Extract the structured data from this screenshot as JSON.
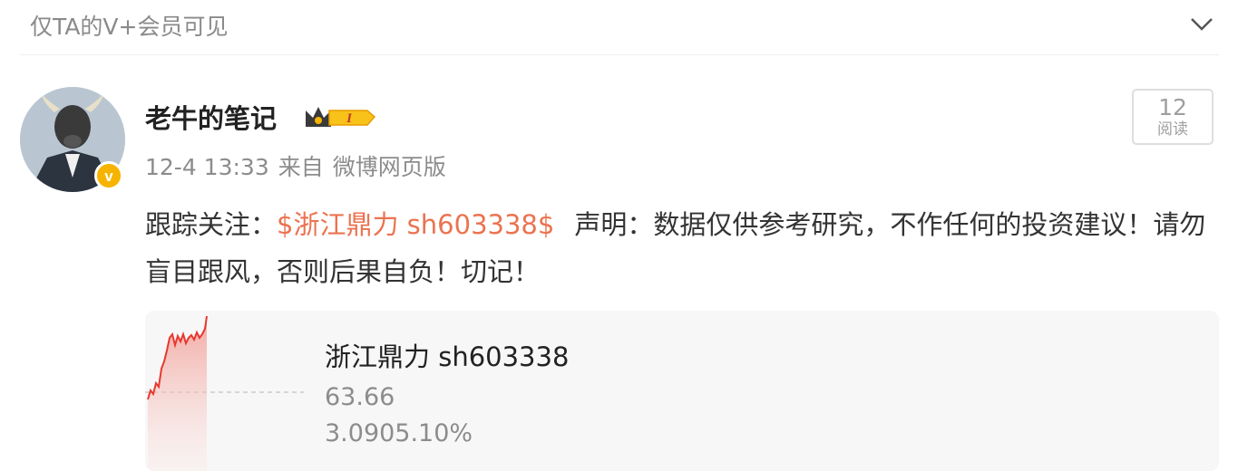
{
  "visibility_text": "仅TA的V+会员可见",
  "icons": {
    "collapse": "chevron-down-icon",
    "verified": "verified-v-badge-icon",
    "vip": "vip-crown-badge-icon"
  },
  "colors": {
    "link": "#eb7350",
    "badge": "#f6b400",
    "chart_red": "#e8382f"
  },
  "post": {
    "username": "老牛的笔记",
    "vip_level": "I",
    "verified_letter": "v",
    "date": "12-4 13:33",
    "source_prefix": "来自",
    "source": "微博网页版",
    "read_count": "12",
    "read_label": "阅读",
    "content": {
      "prefix": "跟踪关注：",
      "stock_link": "$浙江鼎力 sh603338$",
      "disclaimer": "声明：数据仅供参考研究，不作任何的投资建议！请勿盲目跟风，否则后果自负！切记！"
    }
  },
  "stock_card": {
    "name": "浙江鼎力 sh603338",
    "price": "63.66",
    "change": "3.0905.10%"
  }
}
